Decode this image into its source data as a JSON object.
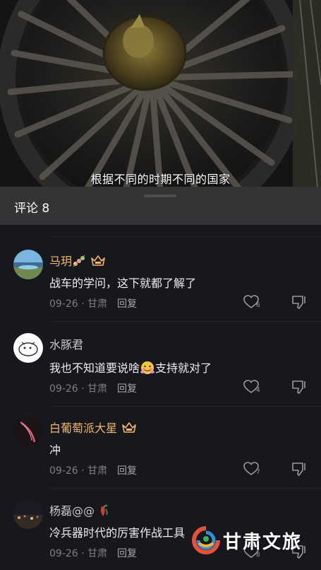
{
  "video": {
    "subtitle": "根据不同的时期不同的国家"
  },
  "comments_panel": {
    "title": "评论 8"
  },
  "comments": [
    {
      "name": "马玥",
      "name_highlight": true,
      "has_crown": true,
      "text": "战车的学问，这下就都了解了",
      "date": "09-26 · 甘肃",
      "reply": "回复",
      "likes": "6"
    },
    {
      "name": "水豚君",
      "name_highlight": false,
      "has_crown": false,
      "text_before": "我也不知道要说啥",
      "text_after": "支持就对了",
      "date": "09-26 · 甘肃",
      "reply": "回复",
      "likes": "4"
    },
    {
      "name": "白葡萄派大星",
      "name_highlight": true,
      "has_crown": true,
      "text": "冲",
      "date": "09-26 · 甘肃",
      "reply": "回复",
      "likes": "7"
    },
    {
      "name": "杨磊@@",
      "name_highlight": false,
      "has_crown": false,
      "text": "冷兵器时代的厉害作战工具",
      "date": "09-26 · 甘肃",
      "reply": "回复",
      "likes": "8"
    }
  ],
  "watermark": {
    "text": "甘肃文旅"
  },
  "colors": {
    "accent_name": "#f5b66a",
    "background": "#17181d",
    "header": "#37373a"
  }
}
